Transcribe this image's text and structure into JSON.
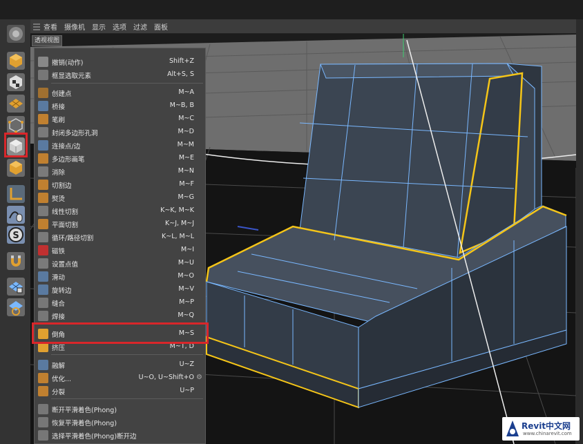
{
  "viewport_menu": [
    "查看",
    "摄像机",
    "显示",
    "选项",
    "过滤",
    "面板"
  ],
  "viewport_label": "透视视图",
  "left_tools": [
    "cube-icon",
    "checker-cube-icon",
    "plane-grid-icon",
    "point-mode-icon",
    "polygon-mode-icon",
    "object-mode-icon",
    "axis-icon",
    "spline-mouse-icon",
    "s-snap-icon",
    "magnet-icon",
    "lock-grid-icon",
    "workplane-icon"
  ],
  "menu": {
    "items": [
      {
        "label": "撤销(动作)",
        "shortcut": "Shift+Z",
        "icon": "undo-icon"
      },
      {
        "label": "框显选取元素",
        "shortcut": "Alt+S, S",
        "icon": "frame-selection-icon"
      },
      {
        "label": "创建点",
        "shortcut": "M~A",
        "icon": "create-point-icon"
      },
      {
        "label": "桥接",
        "shortcut": "M~B, B",
        "icon": "bridge-icon"
      },
      {
        "label": "笔刷",
        "shortcut": "M~C",
        "icon": "brush-icon"
      },
      {
        "label": "封闭多边形孔洞",
        "shortcut": "M~D",
        "icon": "close-hole-icon"
      },
      {
        "label": "连接点/边",
        "shortcut": "M~M",
        "icon": "connect-icon"
      },
      {
        "label": "多边形画笔",
        "shortcut": "M~E",
        "icon": "polygon-pen-icon"
      },
      {
        "label": "消除",
        "shortcut": "M~N",
        "icon": "dissolve-icon"
      },
      {
        "label": "切割边",
        "shortcut": "M~F",
        "icon": "cut-edges-icon"
      },
      {
        "label": "熨烫",
        "shortcut": "M~G",
        "icon": "iron-icon"
      },
      {
        "label": "线性切割",
        "shortcut": "K~K, M~K",
        "icon": "line-cut-icon"
      },
      {
        "label": "平面切割",
        "shortcut": "K~J, M~J",
        "icon": "plane-cut-icon"
      },
      {
        "label": "循环/路径切割",
        "shortcut": "K~L, M~L",
        "icon": "loop-cut-icon"
      },
      {
        "label": "磁铁",
        "shortcut": "M~I",
        "icon": "magnet-icon"
      },
      {
        "label": "设置点值",
        "shortcut": "M~U",
        "icon": "set-point-value-icon"
      },
      {
        "label": "滑动",
        "shortcut": "M~O",
        "icon": "slide-icon"
      },
      {
        "label": "旋转边",
        "shortcut": "M~V",
        "icon": "spin-edge-icon"
      },
      {
        "label": "缝合",
        "shortcut": "M~P",
        "icon": "stitch-icon"
      },
      {
        "label": "焊接",
        "shortcut": "M~Q",
        "icon": "weld-icon"
      },
      {
        "label": "倒角",
        "shortcut": "M~S",
        "icon": "bevel-icon"
      },
      {
        "label": "挤压",
        "shortcut": "M~T, D",
        "icon": "extrude-icon"
      },
      {
        "label": "融解",
        "shortcut": "U~Z",
        "icon": "melt-icon"
      },
      {
        "label": "优化...",
        "shortcut": "U~O, U~Shift+O",
        "icon": "optimize-icon"
      },
      {
        "label": "分裂",
        "shortcut": "U~P",
        "icon": "split-icon"
      },
      {
        "label": "断开平滑着色(Phong)",
        "shortcut": "",
        "icon": "break-phong-icon"
      },
      {
        "label": "恢复平滑着色(Phong)",
        "shortcut": "",
        "icon": "unbreak-phong-icon"
      },
      {
        "label": "选择平滑着色(Phong)断开边",
        "shortcut": "",
        "icon": "select-phong-edges-icon"
      }
    ]
  },
  "watermark": {
    "title": "Revit中文网",
    "url": "www.chinarevit.com"
  },
  "colors": {
    "highlight": "#d9262a",
    "selection_edge": "#f5c518",
    "wire": "#7ab8ff",
    "model_face": "#3b4552"
  }
}
